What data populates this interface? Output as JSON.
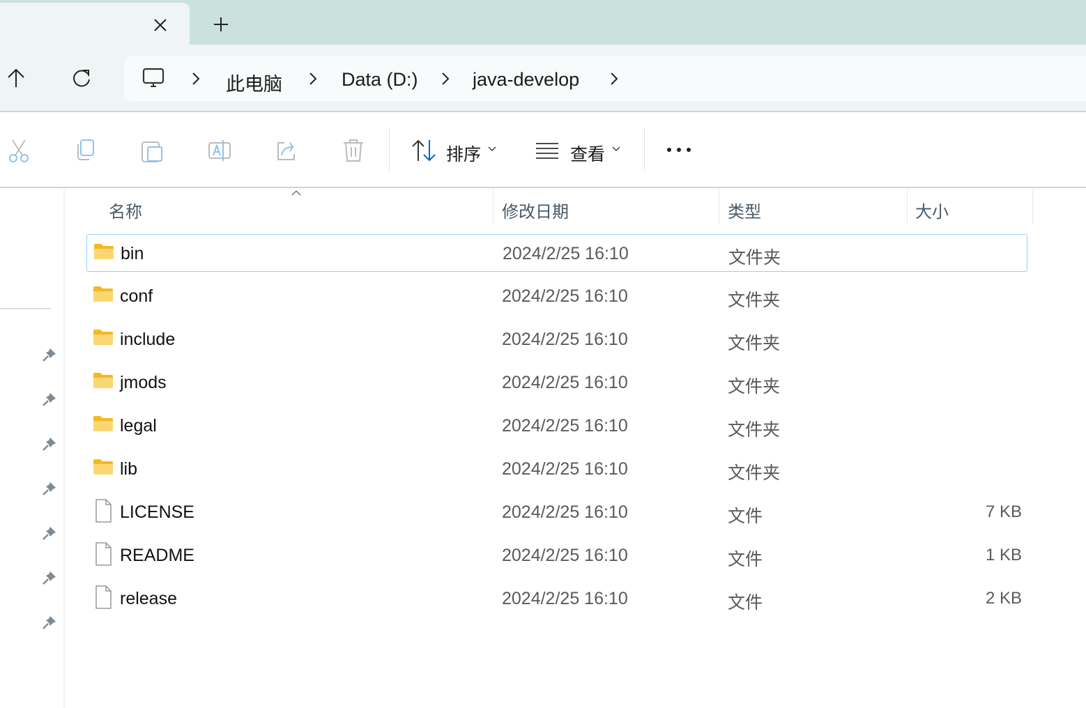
{
  "breadcrumb": [
    "此电脑",
    "Data (D:)",
    "java-develop"
  ],
  "toolbar": {
    "sort_label": "排序",
    "view_label": "查看"
  },
  "columns": {
    "name": "名称",
    "date": "修改日期",
    "type": "类型",
    "size": "大小"
  },
  "files": [
    {
      "name": "bin",
      "date": "2024/2/25 16:10",
      "type": "文件夹",
      "size": "",
      "kind": "folder",
      "selected": true
    },
    {
      "name": "conf",
      "date": "2024/2/25 16:10",
      "type": "文件夹",
      "size": "",
      "kind": "folder"
    },
    {
      "name": "include",
      "date": "2024/2/25 16:10",
      "type": "文件夹",
      "size": "",
      "kind": "folder"
    },
    {
      "name": "jmods",
      "date": "2024/2/25 16:10",
      "type": "文件夹",
      "size": "",
      "kind": "folder"
    },
    {
      "name": "legal",
      "date": "2024/2/25 16:10",
      "type": "文件夹",
      "size": "",
      "kind": "folder"
    },
    {
      "name": "lib",
      "date": "2024/2/25 16:10",
      "type": "文件夹",
      "size": "",
      "kind": "folder"
    },
    {
      "name": "LICENSE",
      "date": "2024/2/25 16:10",
      "type": "文件",
      "size": "7 KB",
      "kind": "file"
    },
    {
      "name": "README",
      "date": "2024/2/25 16:10",
      "type": "文件",
      "size": "1 KB",
      "kind": "file"
    },
    {
      "name": "release",
      "date": "2024/2/25 16:10",
      "type": "文件",
      "size": "2 KB",
      "kind": "file"
    }
  ],
  "colors": {
    "accent": "#0067c0",
    "selection_border": "#99cdf0",
    "folder": "#f8c94a",
    "tabbar": "#c9e2de"
  }
}
